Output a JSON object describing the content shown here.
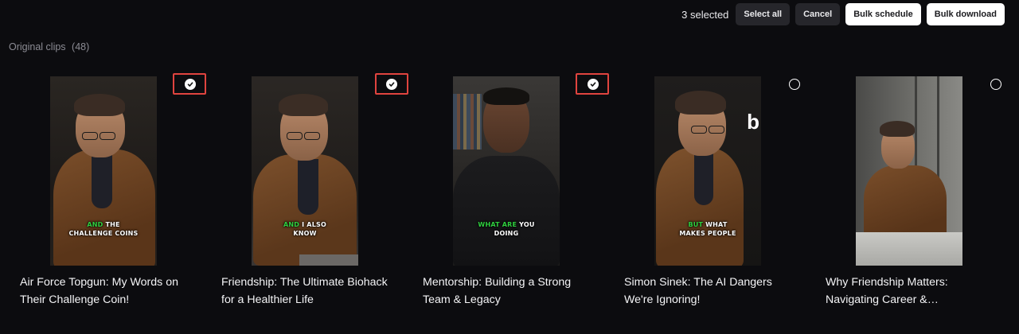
{
  "toolbar": {
    "selected_text": "3 selected",
    "select_all_label": "Select all",
    "cancel_label": "Cancel",
    "bulk_schedule_label": "Bulk schedule",
    "bulk_download_label": "Bulk download"
  },
  "section": {
    "title": "Original clips",
    "count": "(48)"
  },
  "clips": [
    {
      "title": "Air Force Topgun: My Words on Their Challenge Coin!",
      "caption_highlight": "AND",
      "caption_rest": " THE",
      "caption_line2": "CHALLENGE COINS",
      "selected": true
    },
    {
      "title": "Friendship: The Ultimate Biohack for a Healthier Life",
      "caption_highlight": "AND",
      "caption_rest": " I ALSO",
      "caption_line2": "KNOW",
      "selected": true
    },
    {
      "title": "Mentorship: Building a Strong Team & Legacy",
      "caption_highlight": "WHAT ARE",
      "caption_rest": " YOU",
      "caption_line2": "DOING",
      "selected": true
    },
    {
      "title": "Simon Sinek: The AI Dangers We're Ignoring!",
      "caption_highlight": "BUT",
      "caption_rest": " WHAT",
      "caption_line2": "MAKES PEOPLE",
      "brand_mark": "b",
      "selected": false
    },
    {
      "title": "Why Friendship Matters: Navigating Career &…",
      "caption_highlight": "",
      "caption_rest": "",
      "caption_line2": "",
      "selected": false
    }
  ],
  "colors": {
    "background": "#0c0c0f",
    "caption_highlight": "#2fcf3f",
    "selection_outline": "#e0443f"
  },
  "icons": {
    "checked": "check-circle-icon",
    "unchecked": "empty-circle-icon"
  }
}
